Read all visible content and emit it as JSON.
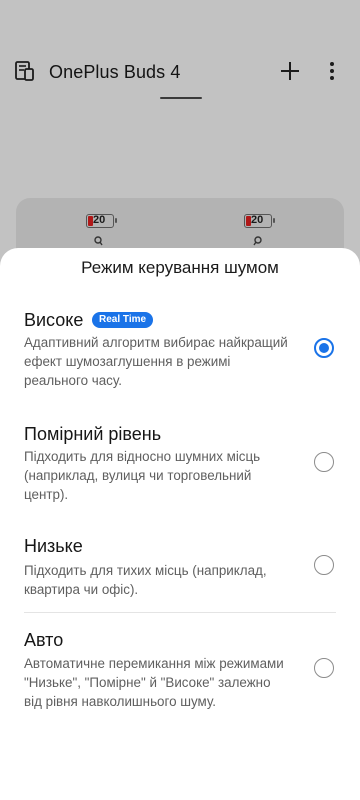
{
  "app": {
    "title": "OnePlus Buds 4",
    "icons": {
      "devices": "devices-icon",
      "add": "plus-icon",
      "menu": "more-vertical-icon"
    }
  },
  "earbuds": {
    "left": {
      "battery_percent": 20,
      "battery_label": "20"
    },
    "right": {
      "battery_percent": 20,
      "battery_label": "20"
    },
    "battery_low_color": "#b01818"
  },
  "sheet": {
    "title": "Режим керування шумом",
    "accent_color": "#1a73e8",
    "options": [
      {
        "title": "Високе",
        "badge": "Real Time",
        "description": "Адаптивний алгоритм вибирає найкращий ефект шумозаглушення в режимі реального часу.",
        "selected": true
      },
      {
        "title": "Помірний рівень",
        "description": "Підходить для відносно шумних місць (наприклад, вулиця чи торговельний центр).",
        "selected": false
      },
      {
        "title": "Низьке",
        "description": "Підходить для тихих місць (наприклад, квартира чи офіс).",
        "selected": false
      },
      {
        "title": "Авто",
        "description": "Автоматичне перемикання між режимами \"Низьке\", \"Помірне\" й \"Високе\" залежно від рівня навколишнього шуму.",
        "selected": false
      }
    ]
  }
}
